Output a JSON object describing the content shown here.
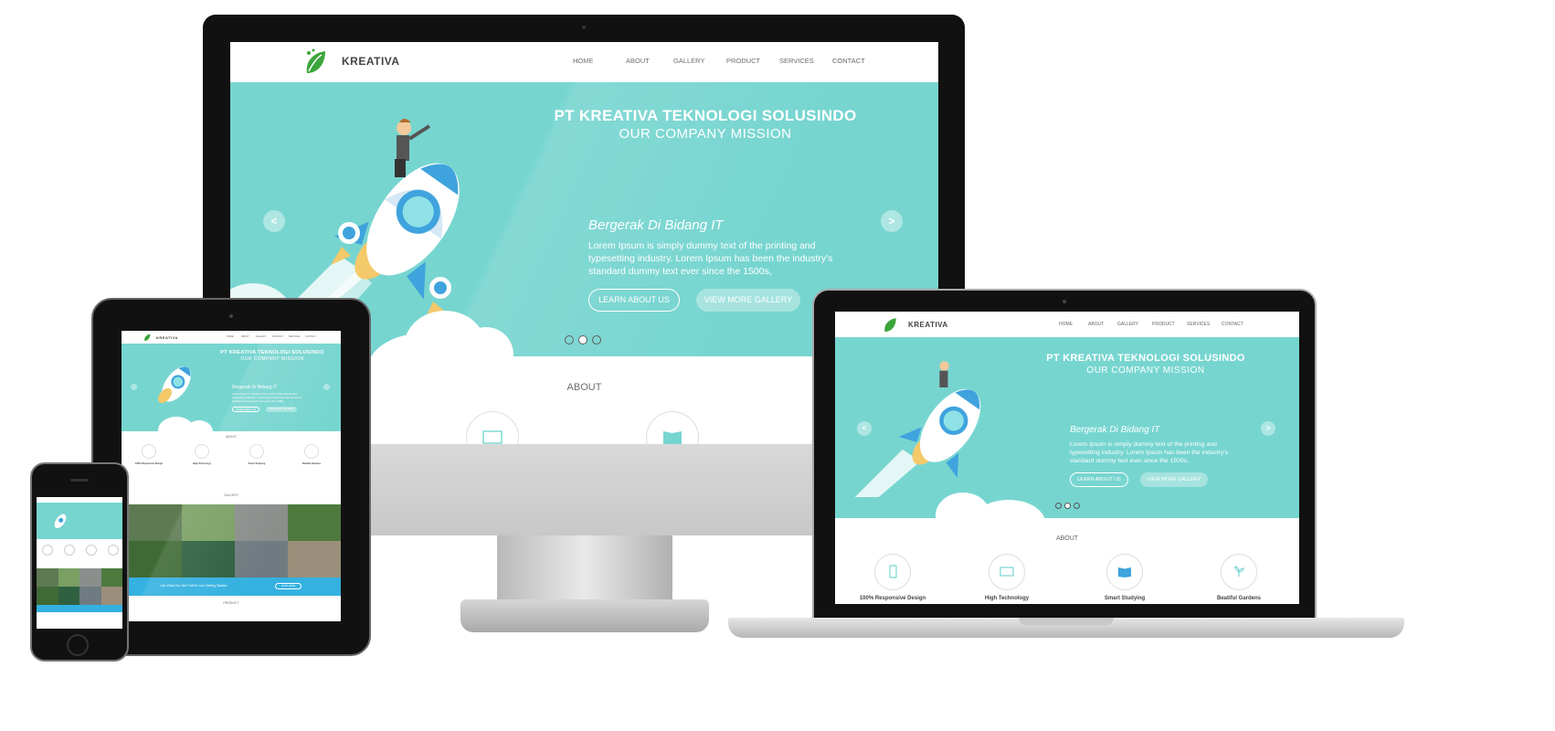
{
  "brand": {
    "name": "KREATIVA"
  },
  "nav": {
    "items": [
      "HOME",
      "ABOUT",
      "GALLERY",
      "PRODUCT",
      "SERVICES",
      "CONTACT"
    ]
  },
  "hero": {
    "title": "PT KREATIVA TEKNOLOGI SOLUSINDO",
    "subtitle": "OUR COMPANY MISSION",
    "tagline": "Bergerak Di Bidang IT",
    "desc_lines": [
      "Lorem Ipsum is simply dummy text of the printing and",
      "typesetting industry. Lorem Ipsum has been the industry's",
      "standard dummy text ever since the 1500s,"
    ],
    "btn_learn": "LEARN ABOUT US",
    "btn_gallery": "VIEW MORE GALLERY",
    "prev": "<",
    "next": ">",
    "active_slide": 2,
    "slides": 3
  },
  "about": {
    "title": "ABOUT",
    "features": [
      {
        "label": "100% Responsive Design",
        "icon": "phone-icon"
      },
      {
        "label": "High Technology",
        "icon": "monitor-icon"
      },
      {
        "label": "Smart Studying",
        "icon": "book-icon"
      },
      {
        "label": "Beatiful Gardens",
        "icon": "plant-icon"
      }
    ]
  },
  "tablet": {
    "gallery_title": "GALLERY",
    "cta_text": "Like What You See? We're Just Getting Started",
    "cta_button": "SHOP MORE",
    "product_title": "PRODUCT"
  },
  "colors": {
    "hero": "#77d5d0",
    "accent": "#34b1e0",
    "leaf": "#3ba53b",
    "btn_fill": "#a6e3df"
  }
}
